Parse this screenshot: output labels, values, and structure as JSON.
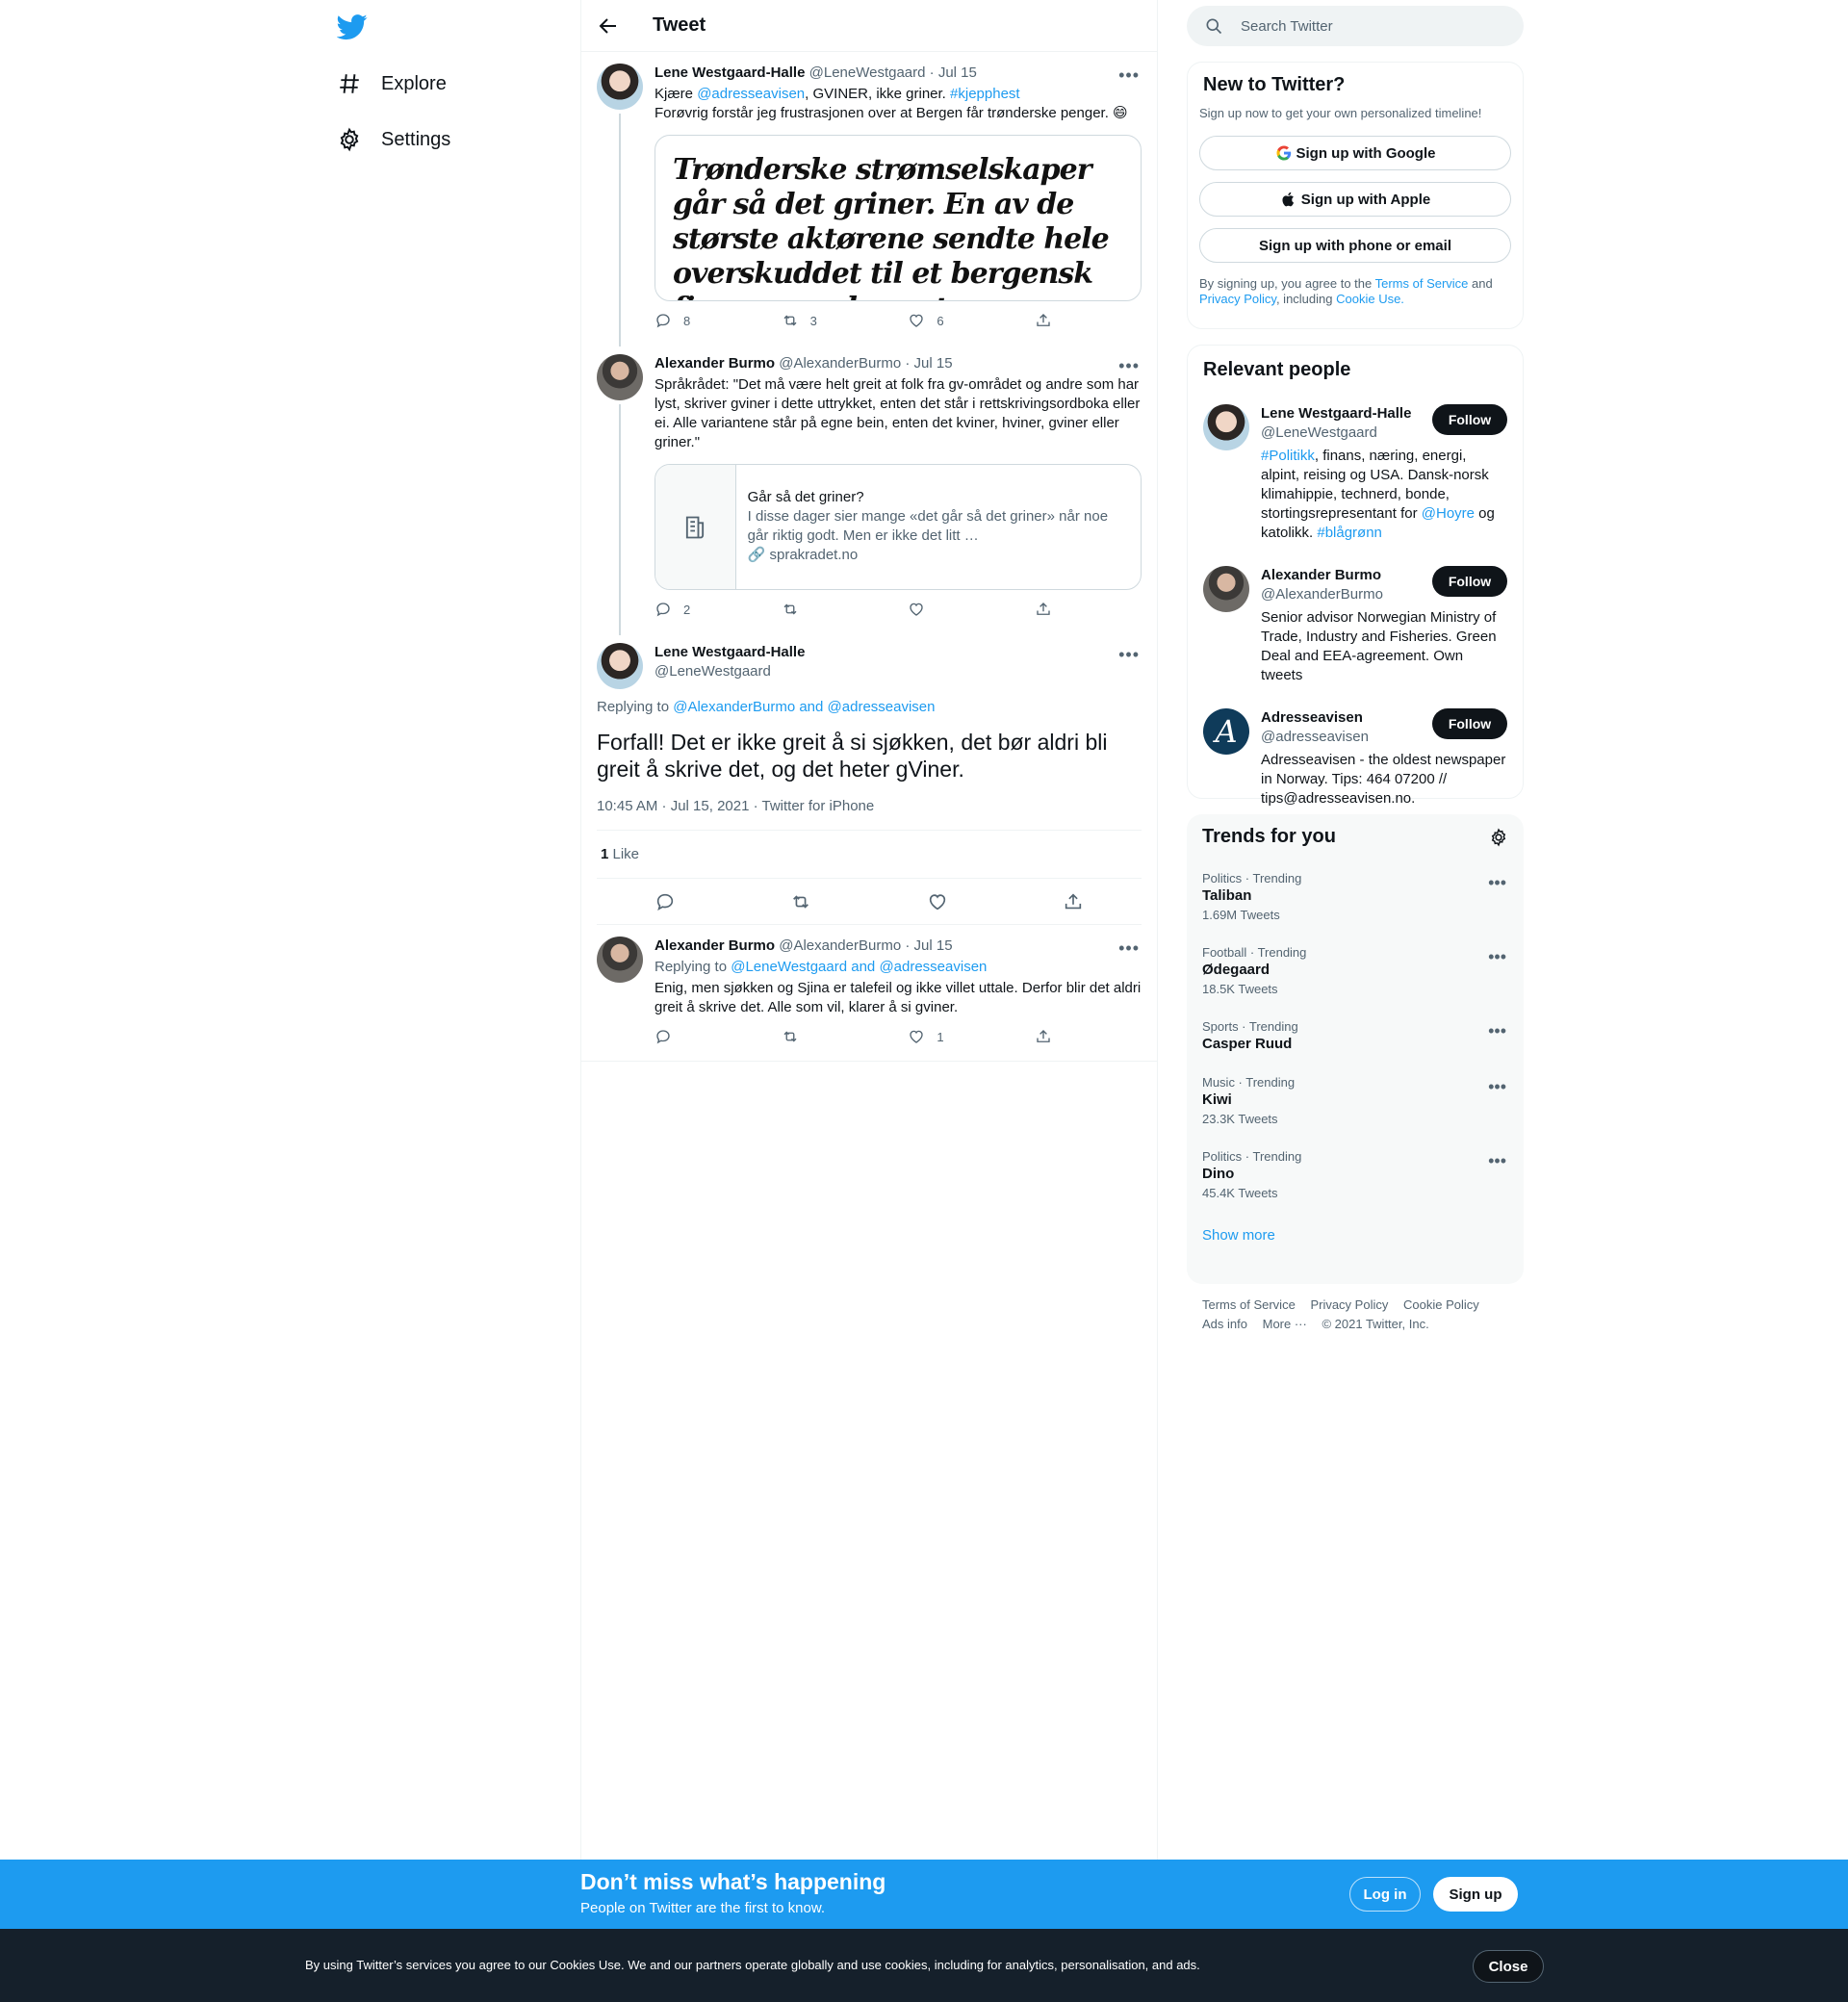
{
  "nav": {
    "items": [
      {
        "label": "Explore",
        "icon": "hashtag-icon"
      },
      {
        "label": "Settings",
        "icon": "gear-icon"
      }
    ]
  },
  "header": {
    "title": "Tweet"
  },
  "thread": [
    {
      "name": "Lene Westgaard-Halle",
      "handle": "@LeneWestgaard",
      "date": "· Jul 15",
      "text_parts": [
        "Kjære ",
        "@adresseavisen",
        ", GVINER, ikke griner. ",
        "#kjepphest"
      ],
      "text_line2": "Forøvrig forstår jeg frustrasjonen over at Bergen får trønderske penger. 😄",
      "image_text": "Trønderske strømselskaper går så det griner. En av de største aktørene sendte hele overskuddet til et bergensk firma som drysset penger",
      "replies": "8",
      "retweets": "3",
      "likes": "6"
    },
    {
      "name": "Alexander Burmo",
      "handle": "@AlexanderBurmo",
      "date": "· Jul 15",
      "text": "Språkrådet: \"Det må være helt greit at folk fra gv-området og andre som har lyst, skriver gviner i dette uttrykket, enten det står i rettskrivingsordboka eller ei. Alle variantene står på egne bein, enten det kviner, hviner, gviner eller griner.\"",
      "card": {
        "title": "Går så det griner?",
        "desc": "I disse dager sier mange «det går så det griner» når noe går riktig godt. Men er ikke det litt …",
        "url": "🔗 sprakradet.no"
      },
      "replies": "2",
      "retweets": "",
      "likes": ""
    }
  ],
  "main_tweet": {
    "name": "Lene Westgaard-Halle",
    "handle": "@LeneWestgaard",
    "replying_prefix": "Replying to ",
    "replying_to": "@AlexanderBurmo and @adresseavisen",
    "text": "Forfall! Det er ikke greit å si sjøkken, det bør aldri bli greit å skrive det, og det heter gViner.",
    "timestamp": "10:45 AM · Jul 15, 2021 · Twitter for iPhone",
    "likes_count": "1",
    "likes_label": " Like"
  },
  "reply": {
    "name": "Alexander Burmo",
    "handle": "@AlexanderBurmo",
    "date": "· Jul 15",
    "replying_prefix": "Replying to ",
    "replying_to": "@LeneWestgaard and @adresseavisen",
    "text": "Enig, men sjøkken og Sjina er talefeil og ikke villet uttale. Derfor blir det aldri greit å skrive det. Alle som vil, klarer å si gviner.",
    "replies": "",
    "retweets": "",
    "likes": "1"
  },
  "search": {
    "placeholder": "Search Twitter"
  },
  "new_to_twitter": {
    "title": "New to Twitter?",
    "subtitle": "Sign up now to get your own personalized timeline!",
    "google": "Sign up with Google",
    "apple": "Sign up with Apple",
    "phone": "Sign up with phone or email",
    "terms_1": "By signing up, you agree to the ",
    "terms_link1": "Terms of Service",
    "terms_2": " and ",
    "terms_link2": "Privacy Policy",
    "terms_3": ", including ",
    "terms_link3": "Cookie Use."
  },
  "relevant_people": {
    "title": "Relevant people",
    "follow_label": "Follow",
    "people": [
      {
        "name": "Lene Westgaard-Halle",
        "handle": "@LeneWestgaard",
        "bio_parts": [
          "#Politikk",
          ", finans, næring, energi, alpint, reising og USA. Dansk-norsk klimahippie, technerd, bonde, stortingsrepresentant for ",
          "@Hoyre",
          " og katolikk. ",
          "#blågrønn"
        ]
      },
      {
        "name": "Alexander Burmo",
        "handle": "@AlexanderBurmo",
        "bio": "Senior advisor Norwegian Ministry of Trade, Industry and Fisheries. Green Deal and EEA-agreement. Own tweets"
      },
      {
        "name": "Adresseavisen",
        "handle": "@adresseavisen",
        "bio": "Adresseavisen - the oldest newspaper in Norway. Tips: 464 07200 // tips@adresseavisen.no."
      }
    ]
  },
  "trends": {
    "title": "Trends for you",
    "items": [
      {
        "category": "Politics · Trending",
        "name": "Taliban",
        "count": "1.69M Tweets"
      },
      {
        "category": "Football · Trending",
        "name": "Ødegaard",
        "count": "18.5K Tweets"
      },
      {
        "category": "Sports · Trending",
        "name": "Casper Ruud",
        "count": ""
      },
      {
        "category": "Music · Trending",
        "name": "Kiwi",
        "count": "23.3K Tweets"
      },
      {
        "category": "Politics · Trending",
        "name": "Dino",
        "count": "45.4K Tweets"
      }
    ],
    "show_more": "Show more"
  },
  "footer": {
    "links": [
      "Terms of Service",
      "Privacy Policy",
      "Cookie Policy",
      "Ads info",
      "More ···",
      "© 2021 Twitter, Inc."
    ]
  },
  "banner": {
    "title": "Don’t miss what’s happening",
    "subtitle": "People on Twitter are the first to know.",
    "login": "Log in",
    "signup": "Sign up"
  },
  "cookie": {
    "text": "By using Twitter’s services you agree to our Cookies Use. We and our partners operate globally and use cookies, including for analytics, personalisation, and ads.",
    "close": "Close"
  },
  "colors": {
    "accent": "#1d9bf0",
    "text": "#0f1419",
    "muted": "#536471",
    "cookie_bg": "#15202b"
  }
}
